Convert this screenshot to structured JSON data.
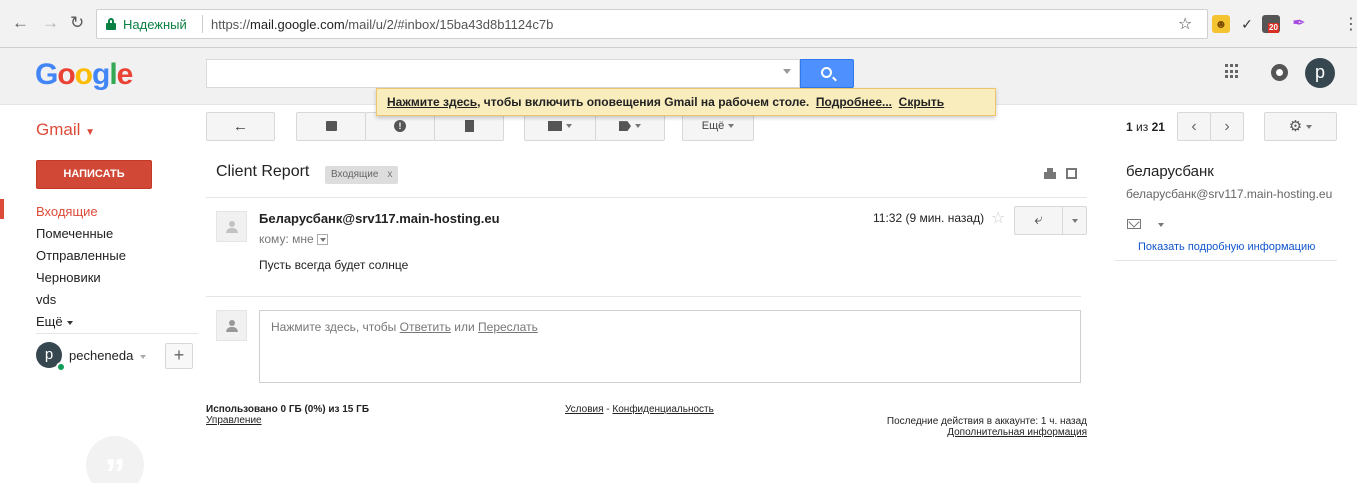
{
  "browser": {
    "secure_label": "Надежный",
    "url_scheme": "https://",
    "url_host": "mail.google.com",
    "url_path": "/mail/u/2/#inbox/15ba43d8b1124c7b",
    "ext_badge": "20"
  },
  "header": {
    "logo_letters": [
      "G",
      "o",
      "o",
      "g",
      "l",
      "e"
    ],
    "logo_colors": [
      "#4285f4",
      "#ea4335",
      "#fbbc05",
      "#4285f4",
      "#34a853",
      "#ea4335"
    ],
    "search_value": "",
    "avatar_letter": "p"
  },
  "notification": {
    "link_here": "Нажмите здесь",
    "text": ", чтобы включить оповещения Gmail на рабочем столе.",
    "more": "Подробнее...",
    "hide": "Скрыть"
  },
  "toolbar": {
    "app_label": "Gmail",
    "more_label": "Ещё",
    "count_prefix": "1",
    "count_mid": " из ",
    "count_total": "21"
  },
  "sidebar": {
    "compose_label": "НАПИСАТЬ",
    "items": [
      {
        "label": "Входящие"
      },
      {
        "label": "Помеченные"
      },
      {
        "label": "Отправленные"
      },
      {
        "label": "Черновики"
      },
      {
        "label": "vds"
      },
      {
        "label": "Ещё"
      }
    ],
    "user_letter": "p",
    "user_name": "pecheneda",
    "plus_label": "+"
  },
  "message": {
    "subject": "Client Report",
    "label_chip": "Входящие",
    "label_chip_x": "x",
    "sender": "Беларусбанк@srv117.main-hosting.eu",
    "to_me": "кому: мне",
    "time": "11:32 (9 мин. назад)",
    "body": "Пусть всегда будет солнце",
    "reply_prefix": "Нажмите здесь, чтобы ",
    "reply_link": "Ответить",
    "reply_or": " или ",
    "forward_link": "Переслать"
  },
  "footer": {
    "usage": "Использовано 0 ГБ (0%) из 15 ГБ",
    "manage": "Управление",
    "terms": "Условия",
    "terms_sep": " - ",
    "privacy": "Конфиденциальность",
    "last_activity": "Последние действия в аккаунте: 1 ч. назад",
    "more_info": "Дополнительная информация"
  },
  "contact": {
    "name": "беларусбанк",
    "email": "беларусбанк@srv117.main-hosting.eu",
    "details_link": "Показать подробную информацию"
  },
  "colors": {
    "gmail_red": "#dd4b39",
    "compose_red": "#d14836",
    "search_blue": "#4d90fe",
    "secure_green": "#0b8043",
    "link_blue": "#15c"
  }
}
